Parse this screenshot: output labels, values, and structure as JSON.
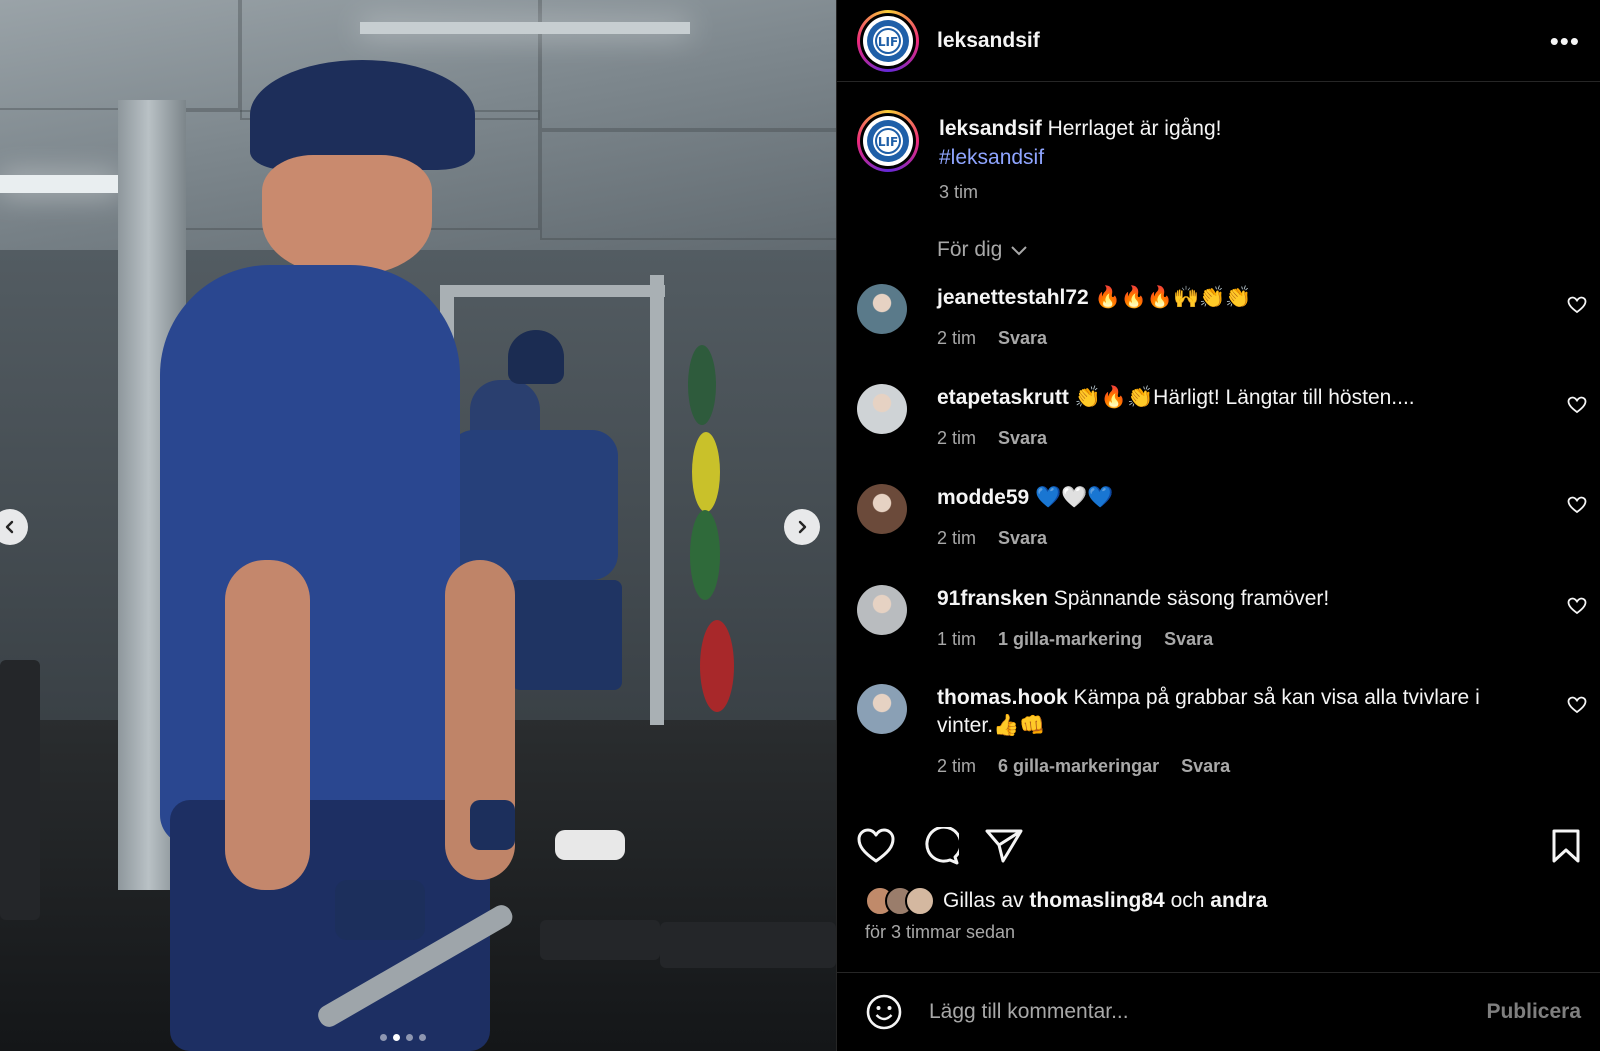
{
  "post": {
    "username": "leksandsif",
    "more_label": "•••",
    "logo_text": "LIF",
    "caption_text": "Herrlaget är igång!",
    "hashtag": "#leksandsif",
    "time": "3 tim",
    "sort_label": "För dig",
    "carousel": {
      "total": 4,
      "active": 1
    }
  },
  "comments": [
    {
      "username": "jeanettestahl72",
      "text": "🔥🔥🔥🙌👏👏",
      "time": "2 tim",
      "likes": "",
      "reply": "Svara",
      "avatar_color": "#5a7a8a"
    },
    {
      "username": "etapetaskrutt",
      "text": "👏🔥👏Härligt! Längtar till hösten....",
      "time": "2 tim",
      "likes": "",
      "reply": "Svara",
      "avatar_color": "#cfd3d6"
    },
    {
      "username": "modde59",
      "text": "💙🤍💙",
      "time": "2 tim",
      "likes": "",
      "reply": "Svara",
      "avatar_color": "#6b4a3a"
    },
    {
      "username": "91fransken",
      "text": "Spännande säsong framöver!",
      "time": "1 tim",
      "likes": "1 gilla-markering",
      "reply": "Svara",
      "avatar_color": "#b9bcbf"
    },
    {
      "username": "thomas.hook",
      "text": "Kämpa på grabbar så kan visa alla tvivlare i vinter.👍👊",
      "time": "2 tim",
      "likes": "6 gilla-markeringar",
      "reply": "Svara",
      "avatar_color": "#8aa0b5"
    }
  ],
  "likes": {
    "prefix": "Gillas av",
    "user": "thomasling84",
    "and": "och",
    "others": "andra",
    "when": "för 3 timmar sedan"
  },
  "composer": {
    "placeholder": "Lägg till kommentar...",
    "publish": "Publicera"
  }
}
